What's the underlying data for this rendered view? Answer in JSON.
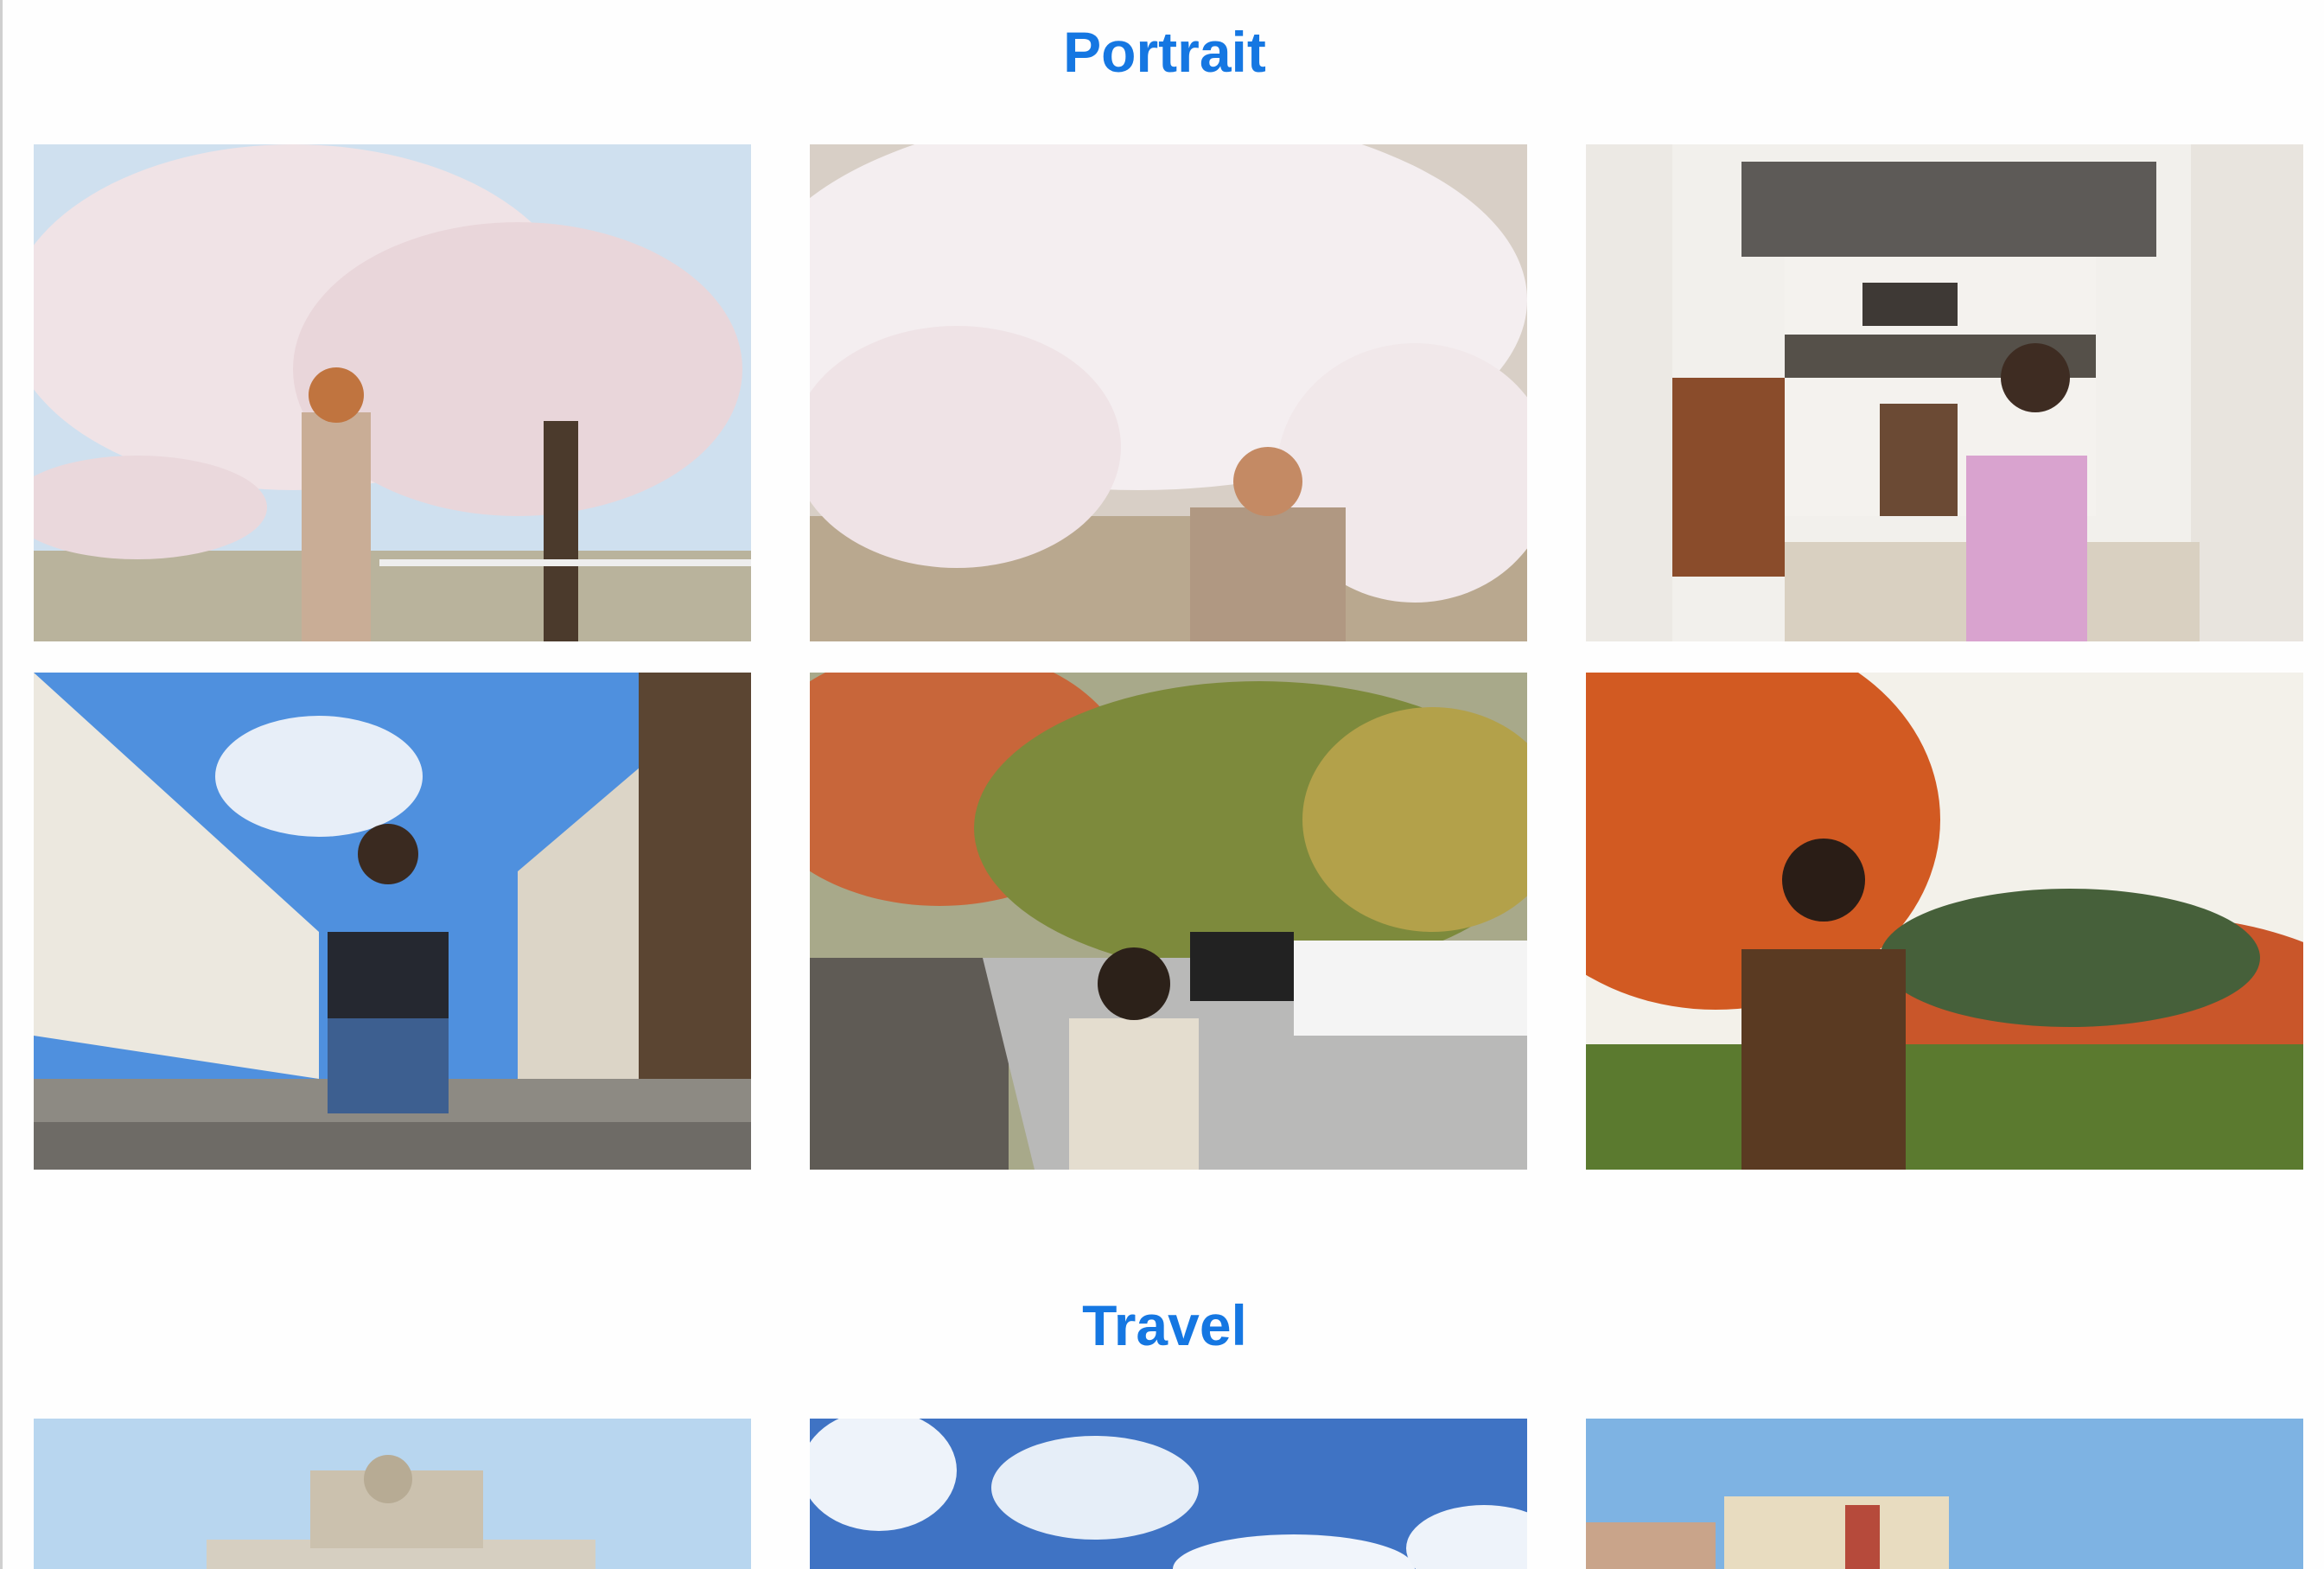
{
  "sections": [
    {
      "title": "Portrait",
      "photos": [
        {
          "subject": "woman-under-cherry-blossom-tree"
        },
        {
          "subject": "woman-reaching-cherry-blossom-branch"
        },
        {
          "subject": "woman-in-kimono-old-street"
        },
        {
          "subject": "man-sitting-on-stone-steps"
        },
        {
          "subject": "woman-on-autumn-street-with-cars"
        },
        {
          "subject": "man-in-autumn-foliage"
        }
      ]
    },
    {
      "title": "Travel",
      "photos": [
        {
          "subject": "ornate-monument-blue-sky"
        },
        {
          "subject": "blue-sky-clouds"
        },
        {
          "subject": "colorful-buildings-blue-sky"
        }
      ]
    }
  ],
  "colors": {
    "accent": "#1577e2",
    "background": "#fefefe"
  }
}
